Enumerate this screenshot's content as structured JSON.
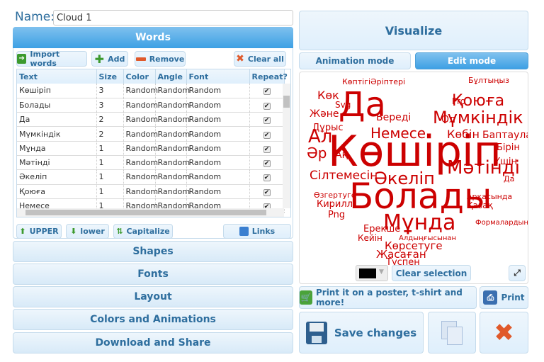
{
  "name": {
    "label": "Name:",
    "value": "Cloud 1"
  },
  "words": {
    "header": "Words",
    "toolbar": {
      "import": "Import words",
      "add": "Add",
      "remove": "Remove",
      "clear": "Clear all"
    },
    "columns": [
      "Text",
      "Size",
      "Color",
      "Angle",
      "Font",
      "Repeat?"
    ],
    "rows": [
      [
        "Көшіріп",
        "3",
        "Random",
        "Random",
        "Random",
        true
      ],
      [
        "Болады",
        "3",
        "Random",
        "Random",
        "Random",
        true
      ],
      [
        "Да",
        "2",
        "Random",
        "Random",
        "Random",
        true
      ],
      [
        "Мүмкіндік",
        "2",
        "Random",
        "Random",
        "Random",
        true
      ],
      [
        "Мұнда",
        "1",
        "Random",
        "Random",
        "Random",
        true
      ],
      [
        "Мәтінді",
        "1",
        "Random",
        "Random",
        "Random",
        true
      ],
      [
        "Әкеліп",
        "1",
        "Random",
        "Random",
        "Random",
        true
      ],
      [
        "Қоюға",
        "1",
        "Random",
        "Random",
        "Random",
        true
      ],
      [
        "Немесе",
        "1",
        "Random",
        "Random",
        "Random",
        true
      ]
    ],
    "case": {
      "upper": "UPPER",
      "lower": "lower",
      "capitalize": "Capitalize",
      "links": "Links"
    }
  },
  "sections": [
    "Shapes",
    "Fonts",
    "Layout",
    "Colors and Animations",
    "Download and Share"
  ],
  "visualize": "Visualize",
  "modes": {
    "animation": "Animation mode",
    "edit": "Edit mode",
    "active": "edit"
  },
  "cloud": {
    "color": "#cc0000",
    "words": [
      "Көшіріп",
      "Болады",
      "Да",
      "Мұнда",
      "Әкеліп",
      "Мәтінді",
      "Мүмкіндік",
      "Қоюға",
      "Немесе",
      "Ал",
      "Сілтемесін",
      "Әр",
      "Көк",
      "Жәнe",
      "Дұрыс",
      "Береді",
      "Көбін",
      "Баптаулар",
      "Көптігі",
      "Әріптері",
      "Бұлтыңыз",
      "Ол",
      "Үшін",
      "Бірін",
      "Көрсетуге",
      "Жасаған",
      "Түспен",
      "Ерекше",
      "Кейін",
      "Кирилл",
      "Png",
      "Өзгертуге",
      "Арқасында",
      "Қазақ",
      "Формалардың",
      "Алдыңғысынан",
      "Svg",
      "Ақ",
      "Pro",
      "Да"
    ],
    "swatch": "#000000",
    "clear_selection": "Clear selection"
  },
  "print_poster": "Print it on a poster, t-shirt and more!",
  "print": "Print",
  "save": "Save changes"
}
